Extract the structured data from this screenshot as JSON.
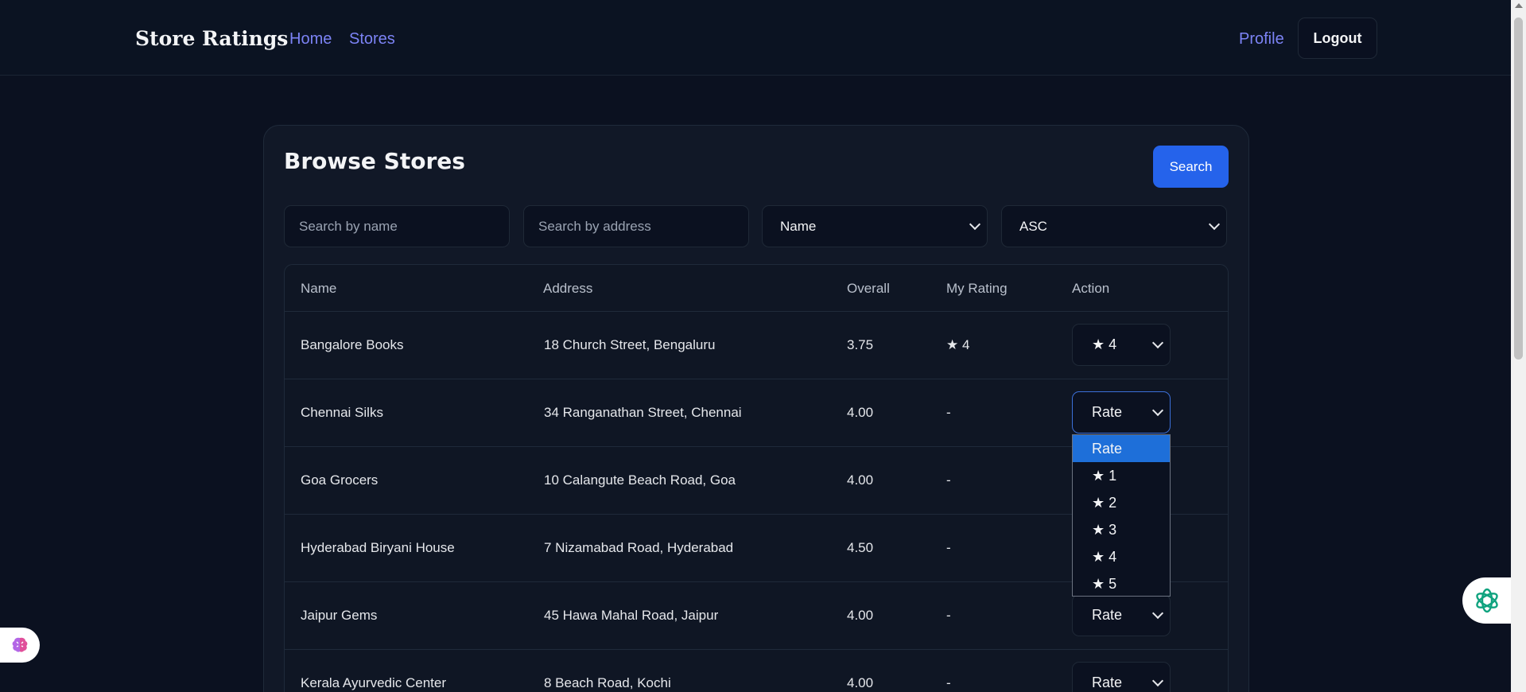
{
  "header": {
    "brand": "Store Ratings",
    "nav": {
      "home": "Home",
      "stores": "Stores"
    },
    "profile": "Profile",
    "logout": "Logout"
  },
  "page": {
    "title": "Browse Stores",
    "search_button": "Search"
  },
  "filters": {
    "name_placeholder": "Search by name",
    "address_placeholder": "Search by address",
    "sort_by": "Name",
    "order": "ASC"
  },
  "table": {
    "headers": {
      "name": "Name",
      "address": "Address",
      "overall": "Overall",
      "my_rating": "My Rating",
      "action": "Action"
    },
    "rows": [
      {
        "name": "Bangalore Books",
        "address": "18 Church Street, Bengaluru",
        "overall": "3.75",
        "my_rating": "★ 4",
        "action": "★ 4"
      },
      {
        "name": "Chennai Silks",
        "address": "34 Ranganathan Street, Chennai",
        "overall": "4.00",
        "my_rating": "-",
        "action": "Rate"
      },
      {
        "name": "Goa Grocers",
        "address": "10 Calangute Beach Road, Goa",
        "overall": "4.00",
        "my_rating": "-",
        "action": ""
      },
      {
        "name": "Hyderabad Biryani House",
        "address": "7 Nizamabad Road, Hyderabad",
        "overall": "4.50",
        "my_rating": "-",
        "action": ""
      },
      {
        "name": "Jaipur Gems",
        "address": "45 Hawa Mahal Road, Jaipur",
        "overall": "4.00",
        "my_rating": "-",
        "action": "Rate"
      },
      {
        "name": "Kerala Ayurvedic Center",
        "address": "8 Beach Road, Kochi",
        "overall": "4.00",
        "my_rating": "-",
        "action": "Rate"
      }
    ]
  },
  "rate_dropdown": {
    "options": [
      "Rate",
      "★ 1",
      "★ 2",
      "★ 3",
      "★ 4",
      "★ 5"
    ],
    "highlighted": "Rate"
  },
  "colors": {
    "accent": "#2563eb",
    "nav_link": "#7c83f5",
    "background": "#0b1120",
    "card": "#111827",
    "dropdown_highlight": "#1e6fd9"
  },
  "icons": {
    "left_widget": "brain-icon",
    "right_widget": "openai-icon"
  }
}
